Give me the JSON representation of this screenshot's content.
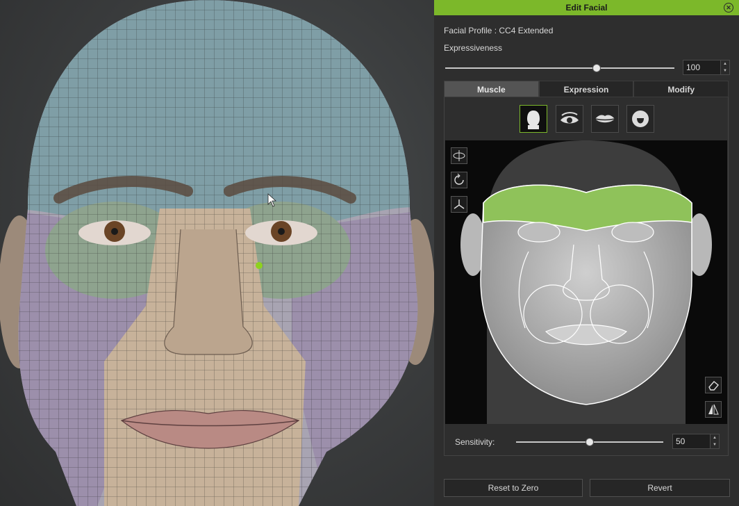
{
  "panel": {
    "title": "Edit Facial",
    "facial_profile": "Facial Profile : CC4 Extended",
    "expressiveness_label": "Expressiveness",
    "expressiveness_value": "100",
    "expressiveness_fraction": 1.0,
    "tabs": [
      {
        "label": "Muscle",
        "active": true
      },
      {
        "label": "Expression",
        "active": false
      },
      {
        "label": "Modify",
        "active": false
      }
    ],
    "region_icons": [
      "head-region-icon",
      "eye-region-icon",
      "mouth-region-icon",
      "tongue-region-icon"
    ],
    "tool_icons": [
      "orbit-icon",
      "rotate-icon",
      "axis-icon"
    ],
    "sensitivity_label": "Sensitivity:",
    "sensitivity_value": "50",
    "sensitivity_fraction": 0.5,
    "reset_label": "Reset to Zero",
    "revert_label": "Revert",
    "accent_color": "#7cb82a"
  }
}
